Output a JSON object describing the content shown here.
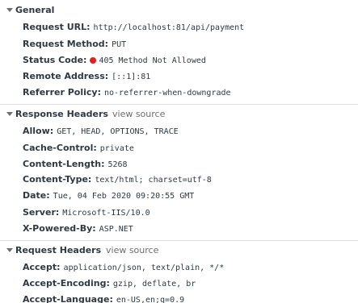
{
  "general": {
    "title": "General",
    "rows": [
      {
        "key": "Request URL:",
        "value": "http://localhost:81/api/payment"
      },
      {
        "key": "Request Method:",
        "value": "PUT"
      },
      {
        "key": "Status Code:",
        "value": "405 Method Not Allowed"
      },
      {
        "key": "Remote Address:",
        "value": "[::1]:81"
      },
      {
        "key": "Referrer Policy:",
        "value": "no-referrer-when-downgrade"
      }
    ]
  },
  "response_headers": {
    "title": "Response Headers",
    "view_source": "view source",
    "rows": [
      {
        "key": "Allow:",
        "value": "GET, HEAD, OPTIONS, TRACE"
      },
      {
        "key": "Cache-Control:",
        "value": "private"
      },
      {
        "key": "Content-Length:",
        "value": "5268"
      },
      {
        "key": "Content-Type:",
        "value": "text/html; charset=utf-8"
      },
      {
        "key": "Date:",
        "value": "Tue, 04 Feb 2020 09:20:55 GMT"
      },
      {
        "key": "Server:",
        "value": "Microsoft-IIS/10.0"
      },
      {
        "key": "X-Powered-By:",
        "value": "ASP.NET"
      }
    ]
  },
  "request_headers": {
    "title": "Request Headers",
    "view_source": "view source",
    "rows": [
      {
        "key": "Accept:",
        "value": "application/json, text/plain, */*"
      },
      {
        "key": "Accept-Encoding:",
        "value": "gzip, deflate, br"
      },
      {
        "key": "Accept-Language:",
        "value": "en-US,en;q=0.9"
      }
    ]
  },
  "colors": {
    "status_error": "#e41f1f",
    "divider": "#e0e0e0"
  }
}
